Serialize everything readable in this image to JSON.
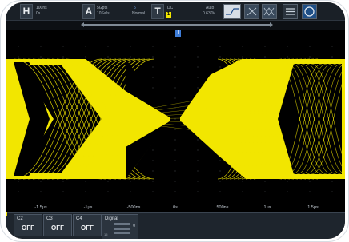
{
  "toolbar": {
    "horizontal_key": "H",
    "horizontal_line1": "100ns",
    "horizontal_line2": "0s",
    "acquire_key": "A",
    "acquire_line1": "5Gpts",
    "acquire_line2": "10Sa/s",
    "acquire_mode": "Normal",
    "acquire_extra": "5",
    "trigger_key": "T",
    "trigger_coupling": "DC",
    "trigger_level_badge": "1",
    "trigger_mode": "Auto",
    "trigger_level_value": "0.630V",
    "trigger_slope_label": "∿"
  },
  "plot": {
    "background": "#000000",
    "trace_color": "#f2e600",
    "grid_color": "#5a5f66"
  },
  "time_axis": {
    "labels": [
      "-1.5µs",
      "-1µs",
      "-500ns",
      "0s",
      "500ns",
      "1µs",
      "1.5µs"
    ]
  },
  "channels": [
    {
      "name": "C2",
      "state": "OFF"
    },
    {
      "name": "C3",
      "state": "OFF"
    },
    {
      "name": "C4",
      "state": "OFF"
    }
  ],
  "digital": {
    "label": "Digital",
    "value": "0",
    "sub": "15"
  },
  "trigger_marker": "T"
}
